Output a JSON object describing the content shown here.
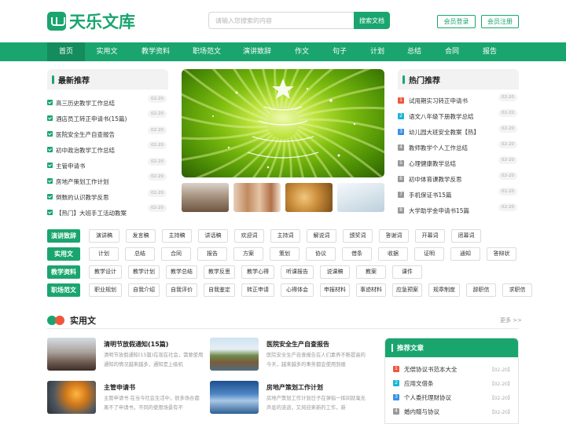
{
  "brand": {
    "name": "天乐文库",
    "accent": "#1aa56f"
  },
  "search": {
    "placeholder": "请输入您搜索的内容",
    "button": "搜索文档"
  },
  "header": {
    "login": "会员登录",
    "register": "会员注册"
  },
  "nav": [
    "首页",
    "实用文",
    "教学资料",
    "职场范文",
    "演讲致辞",
    "作文",
    "句子",
    "计划",
    "总结",
    "合同",
    "报告"
  ],
  "latest": {
    "title": "最新推荐",
    "items": [
      {
        "text": "高三历史教学工作总结",
        "date": "02-20"
      },
      {
        "text": "酒店员工转正申请书(15篇)",
        "date": "02-20"
      },
      {
        "text": "医院安全生产自查报告",
        "date": "02-20"
      },
      {
        "text": "初中政治教学工作总结",
        "date": "02-20"
      },
      {
        "text": "主管申请书",
        "date": "02-20"
      },
      {
        "text": "房地产策划工作计划",
        "date": "02-20"
      },
      {
        "text": "倒数的认识教学反思",
        "date": "02-20"
      },
      {
        "text": "【热门】大班手工活动教案",
        "date": "02-20"
      }
    ]
  },
  "hot": {
    "title": "热门推荐",
    "items": [
      {
        "num": "1",
        "text": "试用期实习转正申请书",
        "date": "02-20"
      },
      {
        "num": "2",
        "text": "语文八年级下册教学总结",
        "date": "02-20"
      },
      {
        "num": "3",
        "text": "幼儿园大班安全教案【热】",
        "date": "02-20"
      },
      {
        "num": "4",
        "text": "教师教学个人工作总结",
        "date": "02-20"
      },
      {
        "num": "5",
        "text": "心理健康教学总结",
        "date": "02-20"
      },
      {
        "num": "6",
        "text": "初中体育课教学反思",
        "date": "02-20"
      },
      {
        "num": "7",
        "text": "手机保证书15篇",
        "date": "02-20"
      },
      {
        "num": "8",
        "text": "大学助学金申请书15篇",
        "date": "02-20"
      }
    ]
  },
  "tag_rows": [
    {
      "category": "演讲致辞",
      "tags": [
        "演讲稿",
        "发言稿",
        "主持稿",
        "讲话稿",
        "欢迎词",
        "主持词",
        "解说词",
        "颁奖词",
        "答谢词",
        "开幕词",
        "闭幕词"
      ]
    },
    {
      "category": "实用文",
      "tags": [
        "计划",
        "总结",
        "合同",
        "报告",
        "方案",
        "策划",
        "协议",
        "借条",
        "收据",
        "证明",
        "通知",
        "答辩状"
      ]
    },
    {
      "category": "教学资料",
      "tags": [
        "教学设计",
        "教学计划",
        "教学总结",
        "教学反思",
        "教学心得",
        "听课报告",
        "说课稿",
        "教案",
        "课件"
      ]
    },
    {
      "category": "职场范文",
      "tags": [
        "职业规划",
        "自我介绍",
        "自我评价",
        "自我鉴定",
        "转正申请",
        "心得体会",
        "申报材料",
        "事迹材料",
        "应急预案",
        "规章制度",
        "辞职信",
        "求职信"
      ]
    }
  ],
  "section": {
    "title": "实用文",
    "more": "更多 >>"
  },
  "articles": [
    {
      "title": "清明节放假通知(15篇)",
      "desc": "清明节放假通知(15篇)在现在社会，需要使用通知的情况越来越多，通知是上级机"
    },
    {
      "title": "医院安全生产自查报告",
      "desc": "医院安全生产自查报告在人们素养不断提高的今天，越来越多的事务都会使用到报"
    },
    {
      "title": "主管申请书",
      "desc": "主管申请书 在当今社会生活中，很多场合都离不了申请书，不同的使用场景有不"
    },
    {
      "title": "房地产策划工作计划",
      "desc": "房地产策划工作计划日子在弹指一挥间就毫无声息的流逝，又将迎来新的工作，新"
    }
  ],
  "recommend": {
    "title": "推荐文章",
    "items": [
      {
        "num": "1",
        "text": "无偿协议书范本大全",
        "date": "【02-20】"
      },
      {
        "num": "2",
        "text": "应用文借条",
        "date": "【02-20】"
      },
      {
        "num": "3",
        "text": "个人委托理财协议",
        "date": "【02-20】"
      },
      {
        "num": "4",
        "text": "婚内赠与协议",
        "date": "【02-20】"
      }
    ]
  },
  "rank_colors": [
    "#f0563e",
    "#1ab5d8",
    "#3b8fe6",
    "#999999"
  ]
}
